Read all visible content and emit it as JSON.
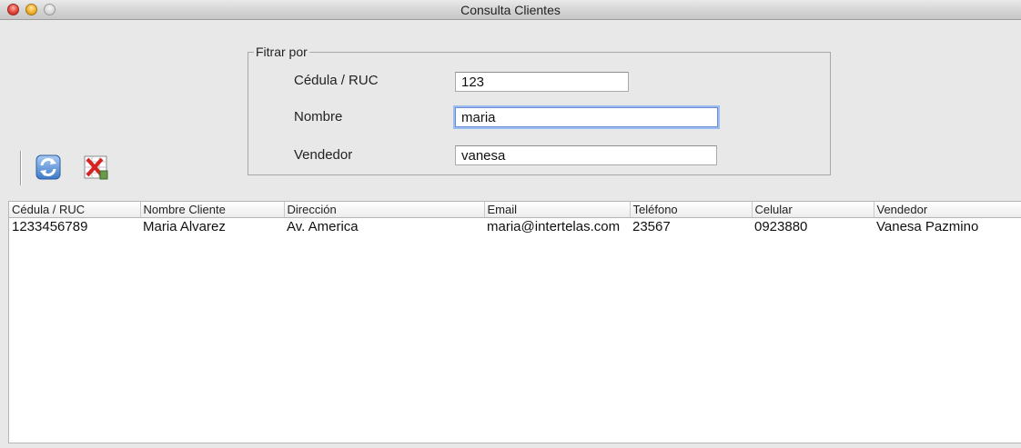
{
  "window": {
    "title": "Consulta Clientes"
  },
  "filter": {
    "legend": "Fitrar por",
    "cedula_label": "Cédula / RUC",
    "cedula_value": "123",
    "nombre_label": "Nombre",
    "nombre_value": "maria",
    "vendedor_label": "Vendedor",
    "vendedor_value": "vanesa"
  },
  "toolbar": {
    "refresh_icon": "refresh-icon",
    "export_icon": "excel-export-icon"
  },
  "table": {
    "headers": [
      "Cédula / RUC",
      "Nombre Cliente",
      "Dirección",
      "Email",
      "Teléfono",
      "Celular",
      "Vendedor"
    ],
    "rows": [
      [
        "1233456789",
        "Maria Alvarez",
        "Av. America",
        "maria@intertelas.com",
        "23567",
        "0923880",
        "Vanesa Pazmino"
      ]
    ]
  }
}
